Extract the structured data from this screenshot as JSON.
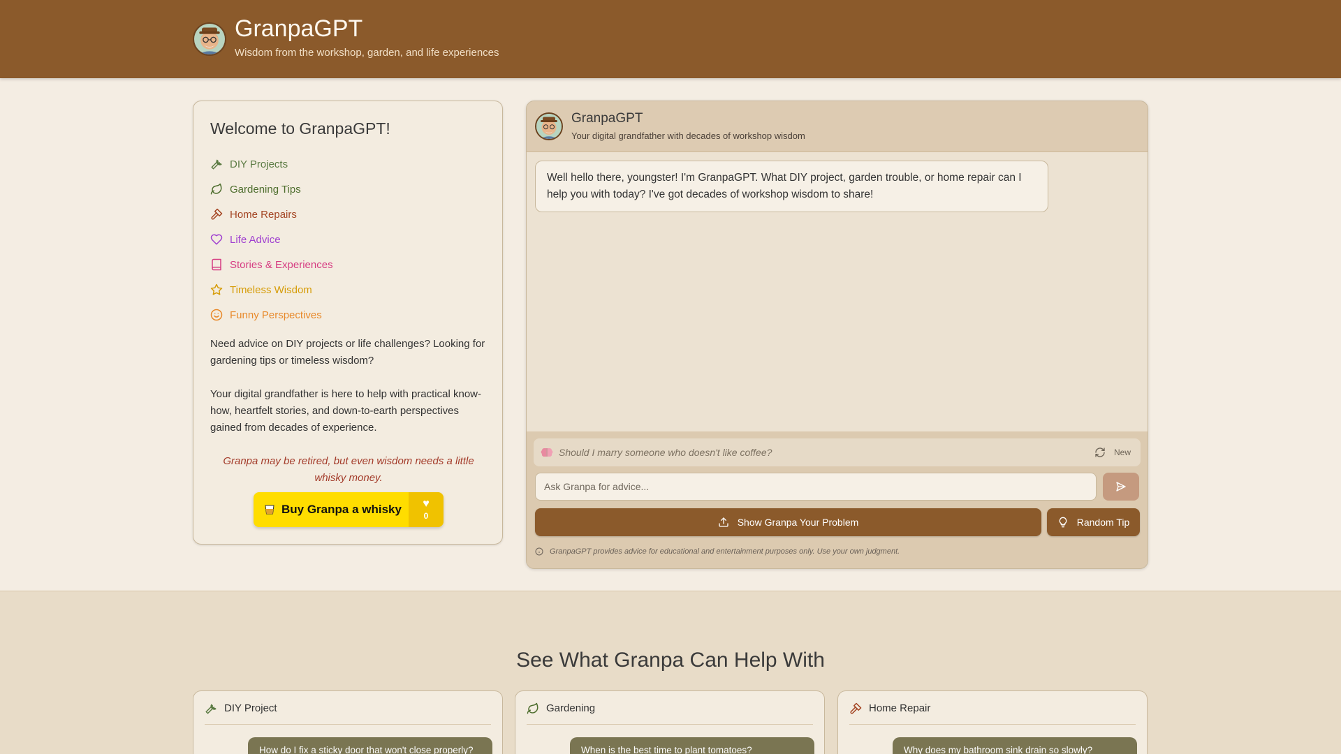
{
  "header": {
    "title": "GranpaGPT",
    "subtitle": "Wisdom from the workshop, garden, and life experiences"
  },
  "sidebar": {
    "welcome": "Welcome to GranpaGPT!",
    "topics": [
      {
        "label": "DIY Projects",
        "icon": "wrench-icon",
        "color": "#5a7a42"
      },
      {
        "label": "Gardening Tips",
        "icon": "leaf-icon",
        "color": "#4e6e2e"
      },
      {
        "label": "Home Repairs",
        "icon": "hammer-icon",
        "color": "#a34422"
      },
      {
        "label": "Life Advice",
        "icon": "heart-icon",
        "color": "#a040d0"
      },
      {
        "label": "Stories & Experiences",
        "icon": "book-icon",
        "color": "#d63c82"
      },
      {
        "label": "Timeless Wisdom",
        "icon": "star-icon",
        "color": "#d69c08"
      },
      {
        "label": "Funny Perspectives",
        "icon": "smile-icon",
        "color": "#e8892a"
      }
    ],
    "paragraph1": "Need advice on DIY projects or life challenges? Looking for gardening tips or timeless wisdom?",
    "paragraph2": "Your digital grandfather is here to help with practical know-how, heartfelt stories, and down-to-earth perspectives gained from decades of experience.",
    "quote": "Granpa may be retired, but even wisdom needs a little whisky money.",
    "donate_label": "Buy Granpa a whisky",
    "donate_count": "0"
  },
  "chat": {
    "title": "GranpaGPT",
    "subtitle": "Your digital grandfather with decades of workshop wisdom",
    "greeting": "Well hello there, youngster! I'm GranpaGPT. What DIY project, garden trouble, or home repair can I help you with today? I've got decades of workshop wisdom to share!",
    "suggestion": "Should I marry someone who doesn't like coffee?",
    "new_label": "New",
    "input_placeholder": "Ask Granpa for advice...",
    "show_problem_label": "Show Granpa Your Problem",
    "random_tip_label": "Random Tip",
    "disclaimer": "GranpaGPT provides advice for educational and entertainment purposes only. Use your own judgment."
  },
  "help_section": {
    "title": "See What Granpa Can Help With",
    "cards": [
      {
        "label": "DIY Project",
        "icon": "wrench-icon",
        "question": "How do I fix a sticky door that won't close properly?"
      },
      {
        "label": "Gardening",
        "icon": "leaf-icon",
        "question": "When is the best time to plant tomatoes?"
      },
      {
        "label": "Home Repair",
        "icon": "hammer-icon",
        "question": "Why does my bathroom sink drain so slowly?"
      }
    ]
  },
  "colors": {
    "brand": "#8b5a2b",
    "background": "#f4ede3",
    "chat_panel": "#dccab0",
    "message_bubble_user": "#7a7552",
    "donate_yellow": "#ffdd00",
    "quote_red": "#a33b2a"
  }
}
